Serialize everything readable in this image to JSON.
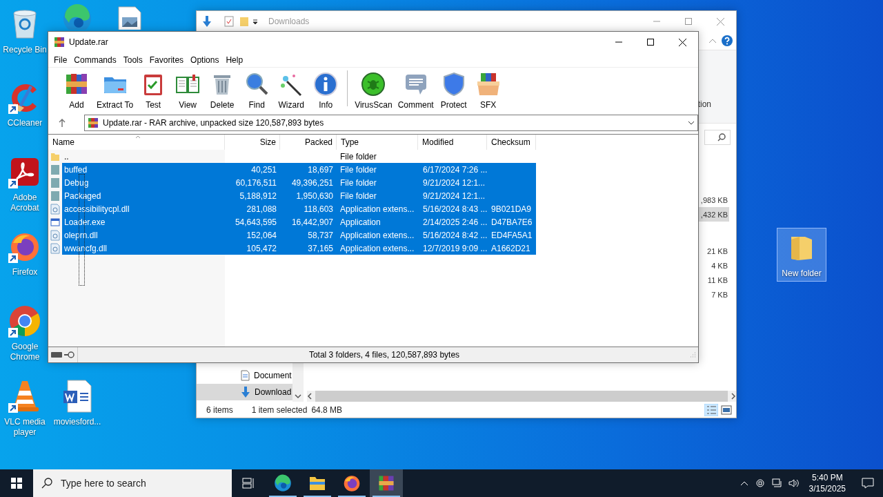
{
  "desktop": {
    "icons": [
      {
        "kind": "recycle-bin",
        "label": "Recycle Bin",
        "selected": false
      },
      {
        "kind": "edge",
        "selected": false
      },
      {
        "kind": "image-file",
        "selected": false
      },
      {
        "kind": "ccleaner",
        "label": "CCleaner",
        "shortcut": true,
        "selected": false
      },
      {
        "kind": "acrobat",
        "label": "Adobe Acrobat",
        "shortcut": true,
        "selected": false
      },
      {
        "kind": "firefox",
        "label": "Firefox",
        "shortcut": true,
        "selected": false
      },
      {
        "kind": "chrome",
        "label": "Google Chrome",
        "shortcut": true,
        "selected": false
      },
      {
        "kind": "vlc",
        "label": "VLC media player",
        "shortcut": true,
        "selected": false
      },
      {
        "kind": "word-doc",
        "label": "moviesford...",
        "selected": false
      },
      {
        "kind": "folder",
        "label": "New folder",
        "selected": true
      }
    ]
  },
  "explorer": {
    "title": "Downloads",
    "ribbon_label": "tion",
    "list": [
      {
        "rows": [
          {
            "size": ",983 KB",
            "selected": false
          },
          {
            "size": ",432 KB",
            "selected": true
          }
        ]
      },
      {
        "rows": [
          {
            "size": "21 KB",
            "selected": false
          },
          {
            "size": "4 KB",
            "selected": false
          },
          {
            "size": "11 KB",
            "selected": false
          },
          {
            "size": "7 KB",
            "selected": false
          }
        ]
      }
    ],
    "nav": [
      {
        "kind": "documents",
        "label": "Document",
        "selected": false
      },
      {
        "kind": "downloads",
        "label": "Download",
        "selected": true
      }
    ],
    "status": {
      "items": "6 items",
      "selection": "1 item selected",
      "size": "64.8 MB"
    }
  },
  "winrar": {
    "title": "Update.rar",
    "menu": [
      "File",
      "Commands",
      "Tools",
      "Favorites",
      "Options",
      "Help"
    ],
    "toolbar": [
      {
        "kind": "add",
        "label": "Add"
      },
      {
        "kind": "extract",
        "label": "Extract To"
      },
      {
        "kind": "test",
        "label": "Test"
      },
      {
        "kind": "view",
        "label": "View"
      },
      {
        "kind": "delete",
        "label": "Delete"
      },
      {
        "kind": "find",
        "label": "Find"
      },
      {
        "kind": "wizard",
        "label": "Wizard"
      },
      {
        "kind": "info",
        "label": "Info"
      },
      {
        "kind": "separator"
      },
      {
        "kind": "virusscan",
        "label": "VirusScan"
      },
      {
        "kind": "comment",
        "label": "Comment"
      },
      {
        "kind": "protect",
        "label": "Protect"
      },
      {
        "kind": "sfx",
        "label": "SFX"
      }
    ],
    "path": "Update.rar - RAR archive, unpacked size 120,587,893 bytes",
    "columns": [
      "Name",
      "Size",
      "Packed",
      "Type",
      "Modified",
      "Checksum"
    ],
    "rows": [
      {
        "kind": "parent",
        "name": "..",
        "type": "File folder",
        "selected": false
      },
      {
        "kind": "folder",
        "name": "buffed",
        "size": "40,251",
        "packed": "18,697",
        "type": "File folder",
        "modified": "6/17/2024 7:26 ...",
        "selected": true
      },
      {
        "kind": "folder",
        "name": "Debug",
        "size": "60,176,511",
        "packed": "49,396,251",
        "type": "File folder",
        "modified": "9/21/2024 12:1...",
        "selected": true
      },
      {
        "kind": "folder",
        "name": "Packaged",
        "size": "5,188,912",
        "packed": "1,950,630",
        "type": "File folder",
        "modified": "9/21/2024 12:1...",
        "selected": true
      },
      {
        "kind": "dll",
        "name": "accessibilitycpl.dll",
        "size": "281,088",
        "packed": "118,603",
        "type": "Application extens...",
        "modified": "5/16/2024 8:43 ...",
        "checksum": "9B021DA9",
        "selected": true
      },
      {
        "kind": "exe",
        "name": "Loader.exe",
        "size": "54,643,595",
        "packed": "16,442,907",
        "type": "Application",
        "modified": "2/14/2025 2:46 ...",
        "checksum": "D47BA7E6",
        "selected": true
      },
      {
        "kind": "dll",
        "name": "oleprn.dll",
        "size": "152,064",
        "packed": "58,737",
        "type": "Application extens...",
        "modified": "5/16/2024 8:42 ...",
        "checksum": "ED4FA5A1",
        "selected": true
      },
      {
        "kind": "dll",
        "name": "wwancfg.dll",
        "size": "105,472",
        "packed": "37,165",
        "type": "Application extens...",
        "modified": "12/7/2019 9:09 ...",
        "checksum": "A1662D21",
        "selected": true
      }
    ],
    "status": "Total 3 folders, 4 files, 120,587,893 bytes"
  },
  "taskbar": {
    "search": {
      "placeholder": "Type here to search"
    },
    "apps": [
      {
        "kind": "task-view",
        "active": false
      },
      {
        "kind": "edge",
        "running": true,
        "active": false
      },
      {
        "kind": "explorer",
        "running": true,
        "active": false
      },
      {
        "kind": "firefox",
        "running": true,
        "active": false
      },
      {
        "kind": "winrar",
        "running": true,
        "active": true
      }
    ],
    "clock": {
      "time": "5:40 PM",
      "date": "3/15/2025"
    }
  }
}
